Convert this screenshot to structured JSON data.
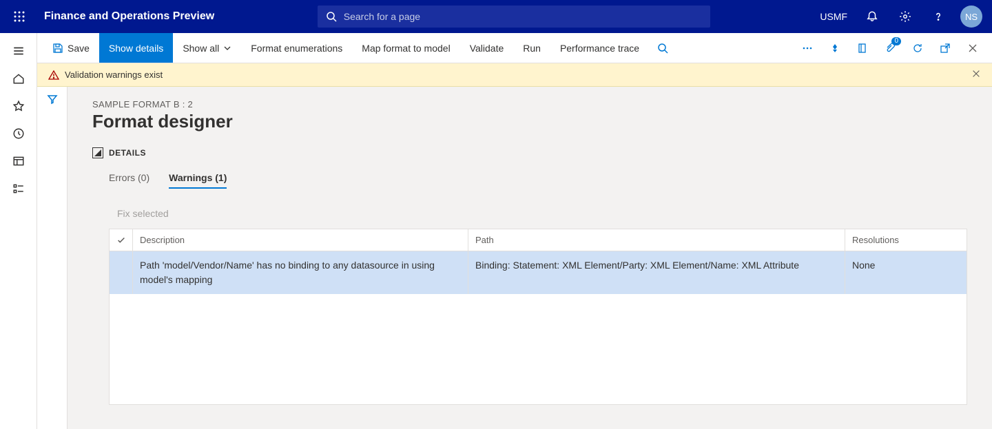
{
  "app": {
    "title": "Finance and Operations Preview"
  },
  "search": {
    "placeholder": "Search for a page"
  },
  "topright": {
    "company": "USMF",
    "avatar_initials": "NS"
  },
  "actionbar": {
    "save": "Save",
    "show_details": "Show details",
    "show_all": "Show all",
    "format_enum": "Format enumerations",
    "map_format": "Map format to model",
    "validate": "Validate",
    "run": "Run",
    "perf_trace": "Performance trace",
    "attach_badge": "0"
  },
  "banner": {
    "text": "Validation warnings exist"
  },
  "page": {
    "breadcrumb": "SAMPLE FORMAT B : 2",
    "title": "Format designer",
    "section": "DETAILS"
  },
  "tabs": {
    "errors": "Errors (0)",
    "warnings": "Warnings (1)"
  },
  "fix": {
    "label": "Fix selected"
  },
  "grid": {
    "headers": {
      "description": "Description",
      "path": "Path",
      "resolutions": "Resolutions"
    },
    "rows": [
      {
        "description": "Path 'model/Vendor/Name' has no binding to any datasource in using model's mapping",
        "path": "Binding: Statement: XML Element/Party: XML Element/Name: XML Attribute",
        "resolutions": "None"
      }
    ]
  }
}
